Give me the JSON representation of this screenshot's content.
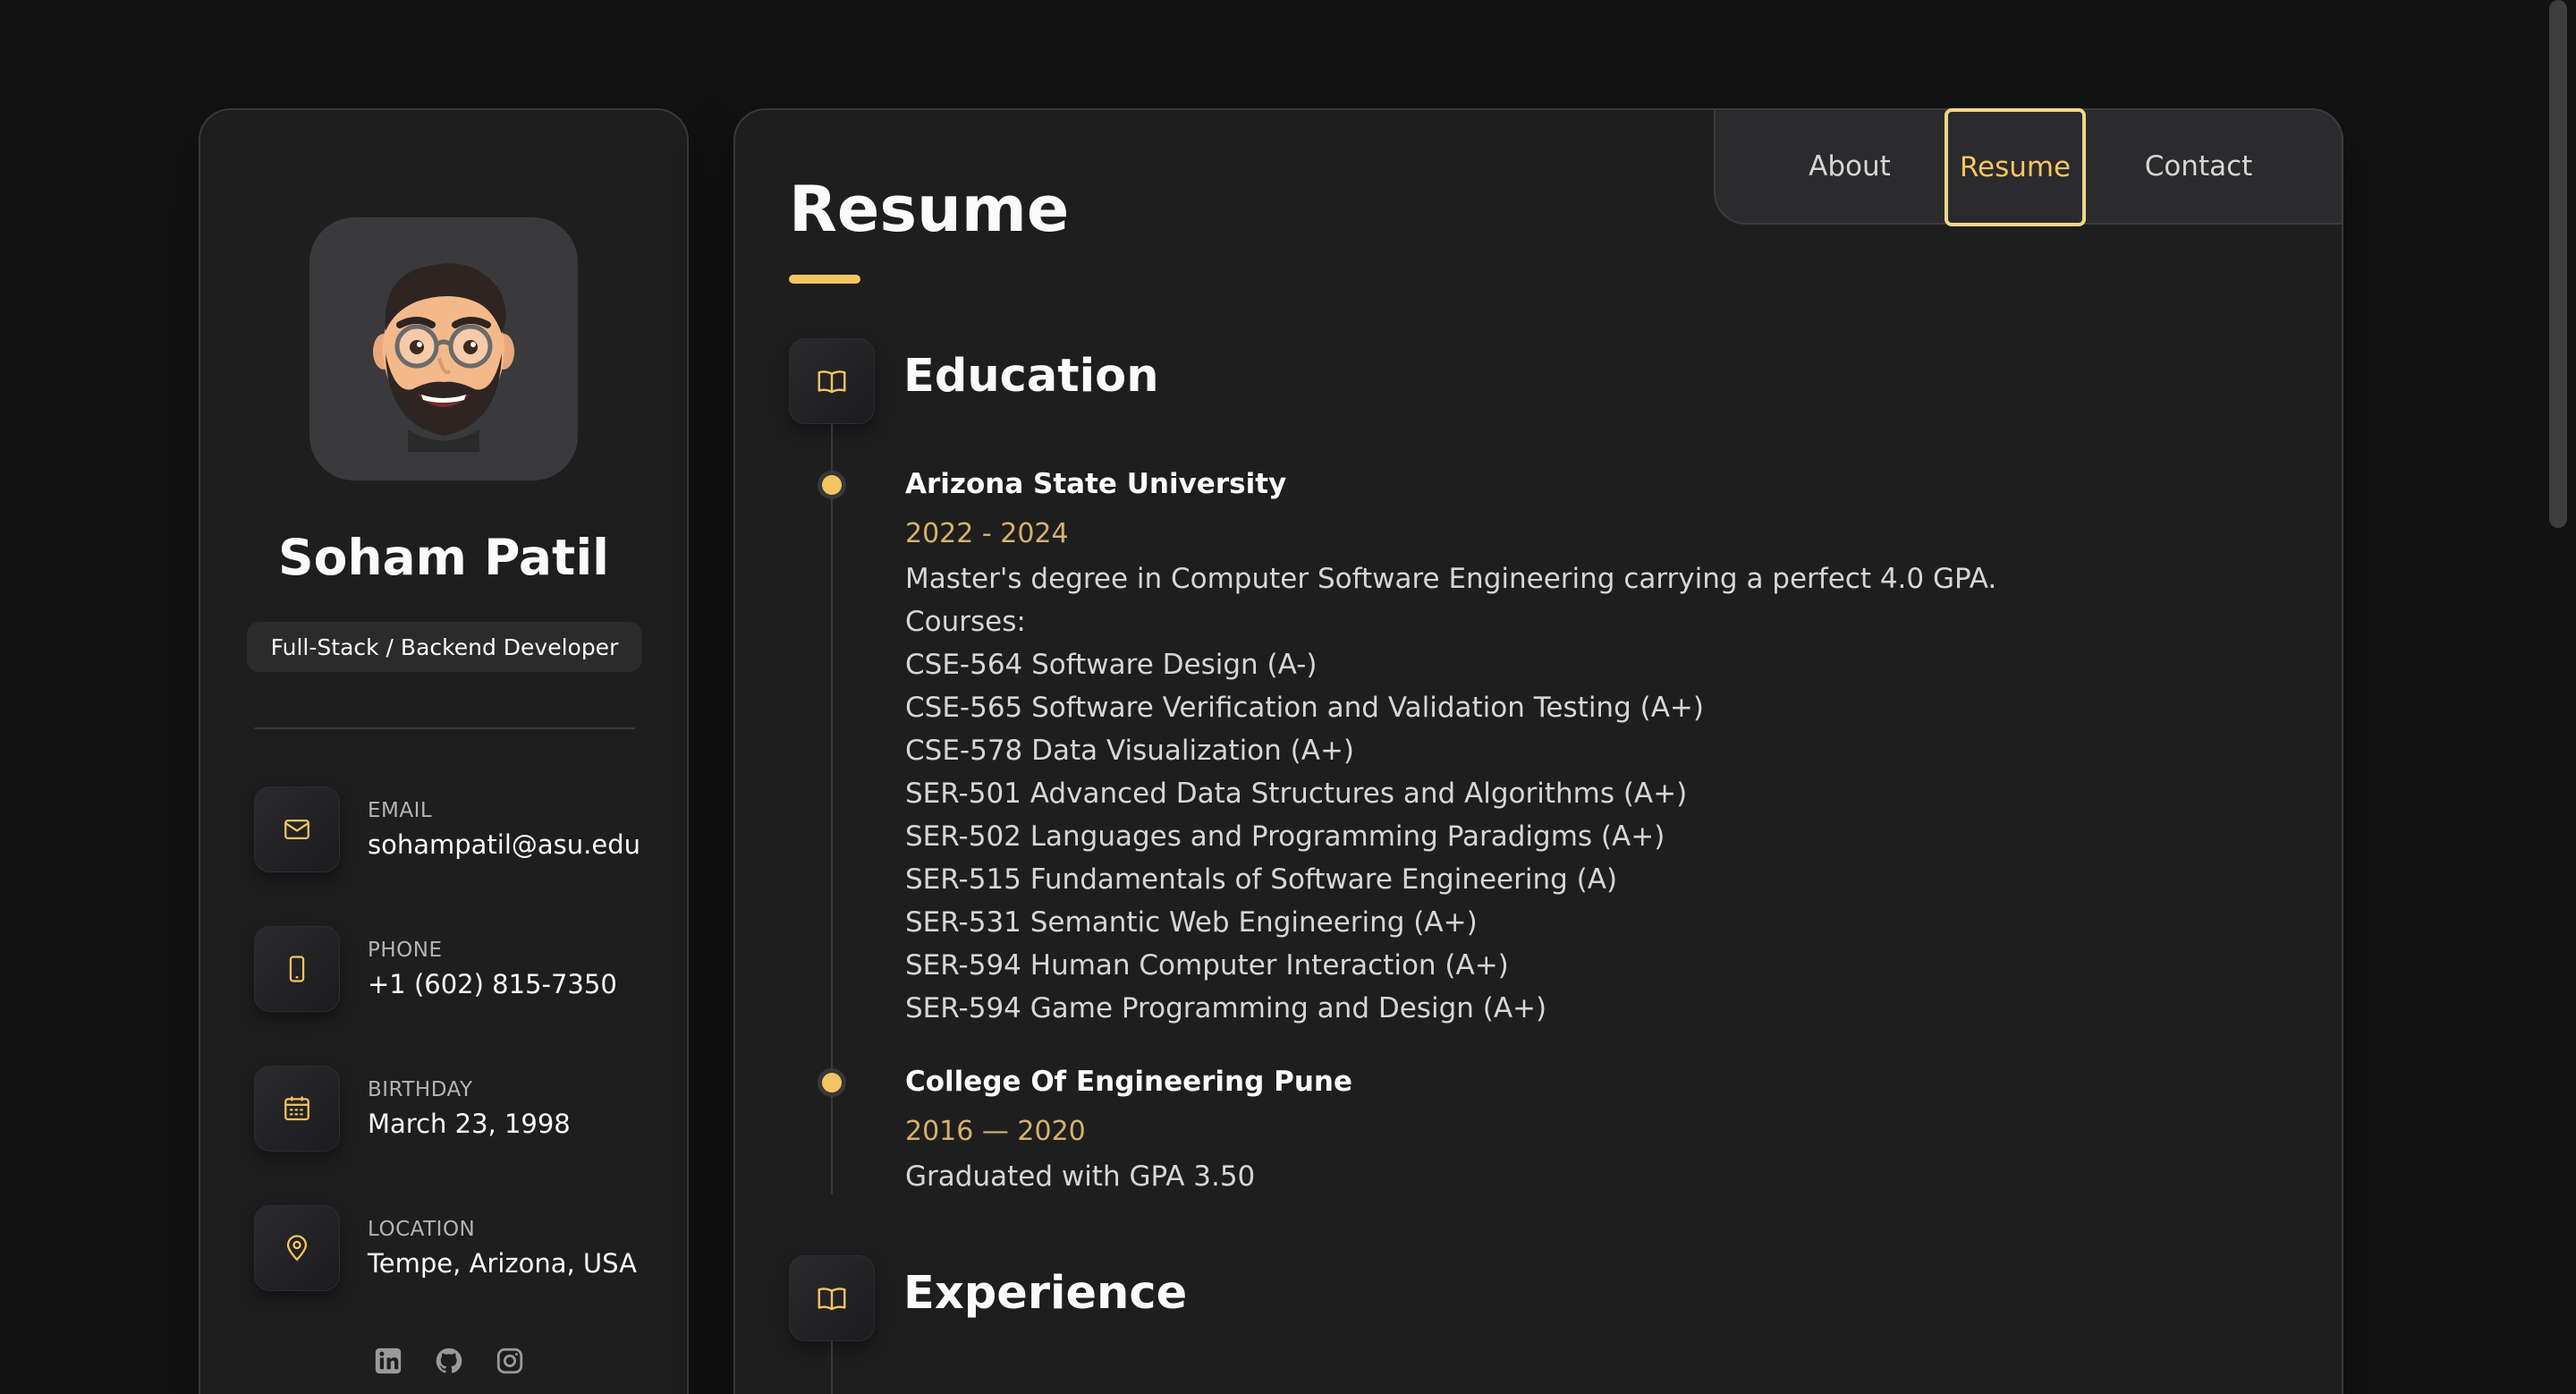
{
  "sidebar": {
    "name": "Soham Patil",
    "title": "Full-Stack / Backend Developer",
    "contacts": [
      {
        "label": "Email",
        "value": "sohampatil@asu.edu",
        "icon": "mail-icon"
      },
      {
        "label": "Phone",
        "value": "+1 (602) 815-7350",
        "icon": "phone-icon"
      },
      {
        "label": "Birthday",
        "value": "March 23, 1998",
        "icon": "calendar-icon"
      },
      {
        "label": "Location",
        "value": "Tempe, Arizona, USA",
        "icon": "location-pin-icon"
      }
    ],
    "socials": [
      "linkedin-icon",
      "github-icon",
      "instagram-icon"
    ]
  },
  "nav": {
    "items": [
      "About",
      "Resume",
      "Contact"
    ],
    "active": "Resume"
  },
  "main": {
    "title": "Resume",
    "education": {
      "title": "Education",
      "items": [
        {
          "title": "Arizona State University",
          "date": "2022 - 2024",
          "lines": [
            "Master's degree in Computer Software Engineering carrying a perfect 4.0 GPA.",
            "Courses:",
            "CSE-564 Software Design (A-)",
            "CSE-565 Software Verification and Validation Testing (A+)",
            "CSE-578 Data Visualization (A+)",
            "SER-501 Advanced Data Structures and Algorithms (A+)",
            "SER-502 Languages and Programming Paradigms (A+)",
            "SER-515 Fundamentals of Software Engineering (A)",
            "SER-531 Semantic Web Engineering (A+)",
            "SER-594 Human Computer Interaction (A+)",
            "SER-594 Game Programming and Design (A+)"
          ]
        },
        {
          "title": "College Of Engineering Pune",
          "date": "2016 — 2020",
          "lines": [
            "Graduated with GPA 3.50"
          ]
        }
      ]
    },
    "experience": {
      "title": "Experience"
    }
  },
  "colors": {
    "accent": "#f5c563",
    "background": "#121212",
    "card": "#1e1e1f"
  }
}
